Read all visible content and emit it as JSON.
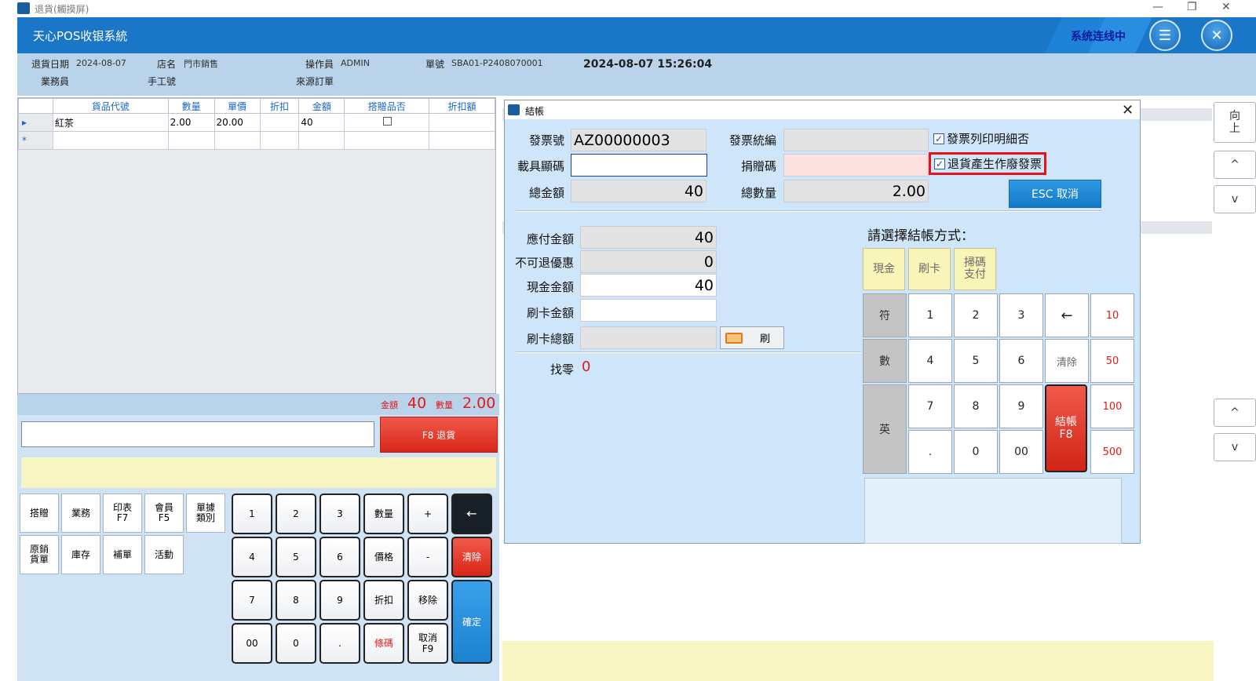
{
  "os_window": {
    "title": "退貨(觸摸屏)",
    "minimize": "—",
    "restore": "❐",
    "close": "✕"
  },
  "header": {
    "app_title": "天心POS收银系統",
    "status": "系统连线中",
    "menu_icon": "list-icon",
    "close_icon": "close-icon"
  },
  "info": {
    "return_date_label": "退貨日期",
    "return_date": "2024-08-07",
    "store_label": "店名",
    "store": "門市銷售",
    "operator_label": "操作員",
    "operator": "ADMIN",
    "order_no_label": "單號",
    "order_no": "SBA01-P2408070001",
    "datetime": "2024-08-07 15:26:04",
    "salesman_label": "業務員",
    "manual_no_label": "手工號",
    "source_order_label": "來源訂單"
  },
  "grid": {
    "columns": [
      "貨品代號",
      "數量",
      "單價",
      "折扣",
      "金額",
      "搭贈品否",
      "折扣額"
    ],
    "rows": [
      {
        "marker": "▸",
        "item": "紅茶",
        "qty": "2.00",
        "price": "20.00",
        "discount": "",
        "amount": "40",
        "gift": false,
        "disc_amt": ""
      }
    ],
    "new_row_marker": "*"
  },
  "totals": {
    "amount_label": "金額",
    "amount": "40",
    "qty_label": "數量",
    "qty": "2.00"
  },
  "left_actions": {
    "f8_return": "F8 退貨",
    "func": [
      "搭贈",
      "業務",
      "印表\nF7",
      "會員\nF5",
      "單據\n類別",
      "原銷\n貨單",
      "庫存",
      "補單",
      "活動"
    ],
    "keys": {
      "k1": "1",
      "k2": "2",
      "k3": "3",
      "qty": "數量",
      "plus": "+",
      "back": "←",
      "k4": "4",
      "k5": "5",
      "k6": "6",
      "price": "價格",
      "minus": "-",
      "clear": "清除",
      "k7": "7",
      "k8": "8",
      "k9": "9",
      "disc": "折扣",
      "remove": "移除",
      "confirm": "確定",
      "k00": "00",
      "k0": "0",
      "dot": ".",
      "barcode": "條碼",
      "cancel": "取消\nF9"
    }
  },
  "dialog": {
    "title": "結帳",
    "invoice_no_label": "發票號",
    "invoice_no": "AZ00000003",
    "tax_id_label": "發票統編",
    "tax_id": "",
    "print_detail_label": "發票列印明細否",
    "print_detail_checked": true,
    "carrier_label": "載具顯碼",
    "carrier": "",
    "donate_label": "捐贈碼",
    "donate": "",
    "void_invoice_label": "退貨產生作廢發票",
    "void_invoice_checked": true,
    "total_amount_label": "總金額",
    "total_amount": "40",
    "total_qty_label": "總數量",
    "total_qty": "2.00",
    "esc_cancel": "ESC 取消",
    "payable_label": "應付金額",
    "payable": "40",
    "non_refundable_label": "不可退優惠",
    "non_refundable": "0",
    "cash_label": "現金金額",
    "cash": "40",
    "card_label": "刷卡金額",
    "card": "",
    "card_total_label": "刷卡總額",
    "card_total": "",
    "swipe_button": "刷",
    "change_label": "找零",
    "change": "0",
    "choose_method": "請選擇結帳方式：",
    "methods": [
      "現金",
      "刷卡",
      "掃碼\n支付"
    ],
    "pad": {
      "sym": "符",
      "num": "數",
      "eng": "英",
      "k1": "1",
      "k2": "2",
      "k3": "3",
      "back": "←",
      "p10": "10",
      "k4": "4",
      "k5": "5",
      "k6": "6",
      "clear": "清除",
      "p50": "50",
      "k7": "7",
      "k8": "8",
      "k9": "9",
      "checkout": "結帳\nF8",
      "p100": "100",
      "dot": ".",
      "k0": "0",
      "k00": "00",
      "p500": "500"
    }
  },
  "rail": {
    "top": "向\n上",
    "up1": "^",
    "down1": "v",
    "up2": "^",
    "down2": "v"
  }
}
